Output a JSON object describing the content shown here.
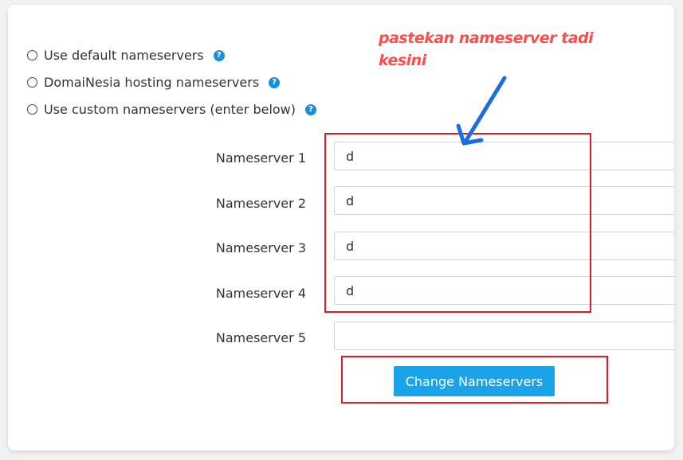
{
  "options": {
    "default_ns": "Use default nameservers",
    "hosting_ns": "DomaiNesia hosting nameservers",
    "custom_ns": "Use custom nameservers (enter below)",
    "help_glyph": "?"
  },
  "nameservers": {
    "label1": "Nameserver 1",
    "label2": "Nameserver 2",
    "label3": "Nameserver 3",
    "label4": "Nameserver 4",
    "label5": "Nameserver 5",
    "value1": "d",
    "value2": "d",
    "value3": "d",
    "value4": "d",
    "value5": ""
  },
  "button": {
    "change": "Change Nameservers"
  },
  "annotation": {
    "text": "pastekan nameserver tadi kesini"
  },
  "colors": {
    "button_bg": "#1aa3e8",
    "help_icon": "#1a8fd6",
    "highlight_box": "#e01b24",
    "annotation_text": "#ff4d4d",
    "arrow": "#1a6fe0"
  },
  "icons": {
    "radio": "radio-unchecked-icon",
    "help": "question-circle-icon",
    "arrow": "arrow-down-left-icon"
  }
}
